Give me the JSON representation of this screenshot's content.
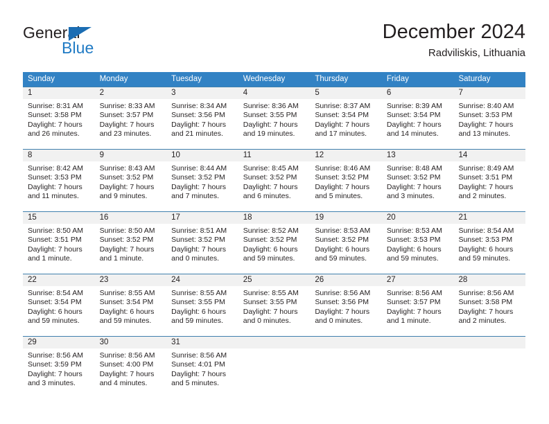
{
  "brand": {
    "word_general": "General",
    "word_blue": "Blue",
    "accent_color": "#1b6db3"
  },
  "header": {
    "title": "December 2024",
    "subtitle": "Radviliskis, Lithuania",
    "header_bg": "#3282c4",
    "daynum_bg": "#f1f1f1"
  },
  "weekdays": [
    "Sunday",
    "Monday",
    "Tuesday",
    "Wednesday",
    "Thursday",
    "Friday",
    "Saturday"
  ],
  "weeks": [
    [
      {
        "day": "1",
        "sunrise": "Sunrise: 8:31 AM",
        "sunset": "Sunset: 3:58 PM",
        "daylight_1": "Daylight: 7 hours",
        "daylight_2": "and 26 minutes."
      },
      {
        "day": "2",
        "sunrise": "Sunrise: 8:33 AM",
        "sunset": "Sunset: 3:57 PM",
        "daylight_1": "Daylight: 7 hours",
        "daylight_2": "and 23 minutes."
      },
      {
        "day": "3",
        "sunrise": "Sunrise: 8:34 AM",
        "sunset": "Sunset: 3:56 PM",
        "daylight_1": "Daylight: 7 hours",
        "daylight_2": "and 21 minutes."
      },
      {
        "day": "4",
        "sunrise": "Sunrise: 8:36 AM",
        "sunset": "Sunset: 3:55 PM",
        "daylight_1": "Daylight: 7 hours",
        "daylight_2": "and 19 minutes."
      },
      {
        "day": "5",
        "sunrise": "Sunrise: 8:37 AM",
        "sunset": "Sunset: 3:54 PM",
        "daylight_1": "Daylight: 7 hours",
        "daylight_2": "and 17 minutes."
      },
      {
        "day": "6",
        "sunrise": "Sunrise: 8:39 AM",
        "sunset": "Sunset: 3:54 PM",
        "daylight_1": "Daylight: 7 hours",
        "daylight_2": "and 14 minutes."
      },
      {
        "day": "7",
        "sunrise": "Sunrise: 8:40 AM",
        "sunset": "Sunset: 3:53 PM",
        "daylight_1": "Daylight: 7 hours",
        "daylight_2": "and 13 minutes."
      }
    ],
    [
      {
        "day": "8",
        "sunrise": "Sunrise: 8:42 AM",
        "sunset": "Sunset: 3:53 PM",
        "daylight_1": "Daylight: 7 hours",
        "daylight_2": "and 11 minutes."
      },
      {
        "day": "9",
        "sunrise": "Sunrise: 8:43 AM",
        "sunset": "Sunset: 3:52 PM",
        "daylight_1": "Daylight: 7 hours",
        "daylight_2": "and 9 minutes."
      },
      {
        "day": "10",
        "sunrise": "Sunrise: 8:44 AM",
        "sunset": "Sunset: 3:52 PM",
        "daylight_1": "Daylight: 7 hours",
        "daylight_2": "and 7 minutes."
      },
      {
        "day": "11",
        "sunrise": "Sunrise: 8:45 AM",
        "sunset": "Sunset: 3:52 PM",
        "daylight_1": "Daylight: 7 hours",
        "daylight_2": "and 6 minutes."
      },
      {
        "day": "12",
        "sunrise": "Sunrise: 8:46 AM",
        "sunset": "Sunset: 3:52 PM",
        "daylight_1": "Daylight: 7 hours",
        "daylight_2": "and 5 minutes."
      },
      {
        "day": "13",
        "sunrise": "Sunrise: 8:48 AM",
        "sunset": "Sunset: 3:52 PM",
        "daylight_1": "Daylight: 7 hours",
        "daylight_2": "and 3 minutes."
      },
      {
        "day": "14",
        "sunrise": "Sunrise: 8:49 AM",
        "sunset": "Sunset: 3:51 PM",
        "daylight_1": "Daylight: 7 hours",
        "daylight_2": "and 2 minutes."
      }
    ],
    [
      {
        "day": "15",
        "sunrise": "Sunrise: 8:50 AM",
        "sunset": "Sunset: 3:51 PM",
        "daylight_1": "Daylight: 7 hours",
        "daylight_2": "and 1 minute."
      },
      {
        "day": "16",
        "sunrise": "Sunrise: 8:50 AM",
        "sunset": "Sunset: 3:52 PM",
        "daylight_1": "Daylight: 7 hours",
        "daylight_2": "and 1 minute."
      },
      {
        "day": "17",
        "sunrise": "Sunrise: 8:51 AM",
        "sunset": "Sunset: 3:52 PM",
        "daylight_1": "Daylight: 7 hours",
        "daylight_2": "and 0 minutes."
      },
      {
        "day": "18",
        "sunrise": "Sunrise: 8:52 AM",
        "sunset": "Sunset: 3:52 PM",
        "daylight_1": "Daylight: 6 hours",
        "daylight_2": "and 59 minutes."
      },
      {
        "day": "19",
        "sunrise": "Sunrise: 8:53 AM",
        "sunset": "Sunset: 3:52 PM",
        "daylight_1": "Daylight: 6 hours",
        "daylight_2": "and 59 minutes."
      },
      {
        "day": "20",
        "sunrise": "Sunrise: 8:53 AM",
        "sunset": "Sunset: 3:53 PM",
        "daylight_1": "Daylight: 6 hours",
        "daylight_2": "and 59 minutes."
      },
      {
        "day": "21",
        "sunrise": "Sunrise: 8:54 AM",
        "sunset": "Sunset: 3:53 PM",
        "daylight_1": "Daylight: 6 hours",
        "daylight_2": "and 59 minutes."
      }
    ],
    [
      {
        "day": "22",
        "sunrise": "Sunrise: 8:54 AM",
        "sunset": "Sunset: 3:54 PM",
        "daylight_1": "Daylight: 6 hours",
        "daylight_2": "and 59 minutes."
      },
      {
        "day": "23",
        "sunrise": "Sunrise: 8:55 AM",
        "sunset": "Sunset: 3:54 PM",
        "daylight_1": "Daylight: 6 hours",
        "daylight_2": "and 59 minutes."
      },
      {
        "day": "24",
        "sunrise": "Sunrise: 8:55 AM",
        "sunset": "Sunset: 3:55 PM",
        "daylight_1": "Daylight: 6 hours",
        "daylight_2": "and 59 minutes."
      },
      {
        "day": "25",
        "sunrise": "Sunrise: 8:55 AM",
        "sunset": "Sunset: 3:55 PM",
        "daylight_1": "Daylight: 7 hours",
        "daylight_2": "and 0 minutes."
      },
      {
        "day": "26",
        "sunrise": "Sunrise: 8:56 AM",
        "sunset": "Sunset: 3:56 PM",
        "daylight_1": "Daylight: 7 hours",
        "daylight_2": "and 0 minutes."
      },
      {
        "day": "27",
        "sunrise": "Sunrise: 8:56 AM",
        "sunset": "Sunset: 3:57 PM",
        "daylight_1": "Daylight: 7 hours",
        "daylight_2": "and 1 minute."
      },
      {
        "day": "28",
        "sunrise": "Sunrise: 8:56 AM",
        "sunset": "Sunset: 3:58 PM",
        "daylight_1": "Daylight: 7 hours",
        "daylight_2": "and 2 minutes."
      }
    ],
    [
      {
        "day": "29",
        "sunrise": "Sunrise: 8:56 AM",
        "sunset": "Sunset: 3:59 PM",
        "daylight_1": "Daylight: 7 hours",
        "daylight_2": "and 3 minutes."
      },
      {
        "day": "30",
        "sunrise": "Sunrise: 8:56 AM",
        "sunset": "Sunset: 4:00 PM",
        "daylight_1": "Daylight: 7 hours",
        "daylight_2": "and 4 minutes."
      },
      {
        "day": "31",
        "sunrise": "Sunrise: 8:56 AM",
        "sunset": "Sunset: 4:01 PM",
        "daylight_1": "Daylight: 7 hours",
        "daylight_2": "and 5 minutes."
      },
      {
        "day": "",
        "sunrise": "",
        "sunset": "",
        "daylight_1": "",
        "daylight_2": ""
      },
      {
        "day": "",
        "sunrise": "",
        "sunset": "",
        "daylight_1": "",
        "daylight_2": ""
      },
      {
        "day": "",
        "sunrise": "",
        "sunset": "",
        "daylight_1": "",
        "daylight_2": ""
      },
      {
        "day": "",
        "sunrise": "",
        "sunset": "",
        "daylight_1": "",
        "daylight_2": ""
      }
    ]
  ]
}
